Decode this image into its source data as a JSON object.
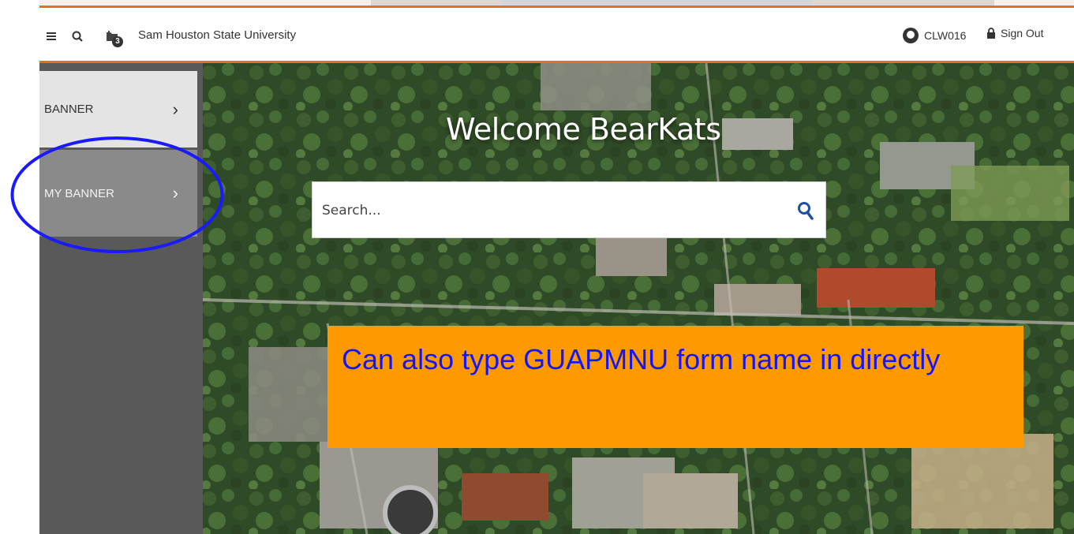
{
  "header": {
    "institution": "Sam Houston State University",
    "recent_count": "3",
    "username": "CLW016",
    "sign_out": "Sign Out"
  },
  "sidebar": {
    "items": [
      {
        "label": "BANNER"
      },
      {
        "label": "MY BANNER"
      }
    ]
  },
  "main": {
    "welcome": "Welcome BearKats",
    "search_placeholder": "Search..."
  },
  "callout": {
    "text": "Can also type GUAPMNU form name in directly"
  },
  "colors": {
    "accent": "#f26b1d",
    "callout_bg": "#ff9900",
    "callout_text": "#1414ff",
    "highlight_ellipse": "#1a1aff",
    "sidebar_bg": "#595959"
  },
  "icons": [
    "menu-icon",
    "search-icon",
    "recent-items-icon",
    "user-icon",
    "lock-icon",
    "chevron-right-icon"
  ]
}
